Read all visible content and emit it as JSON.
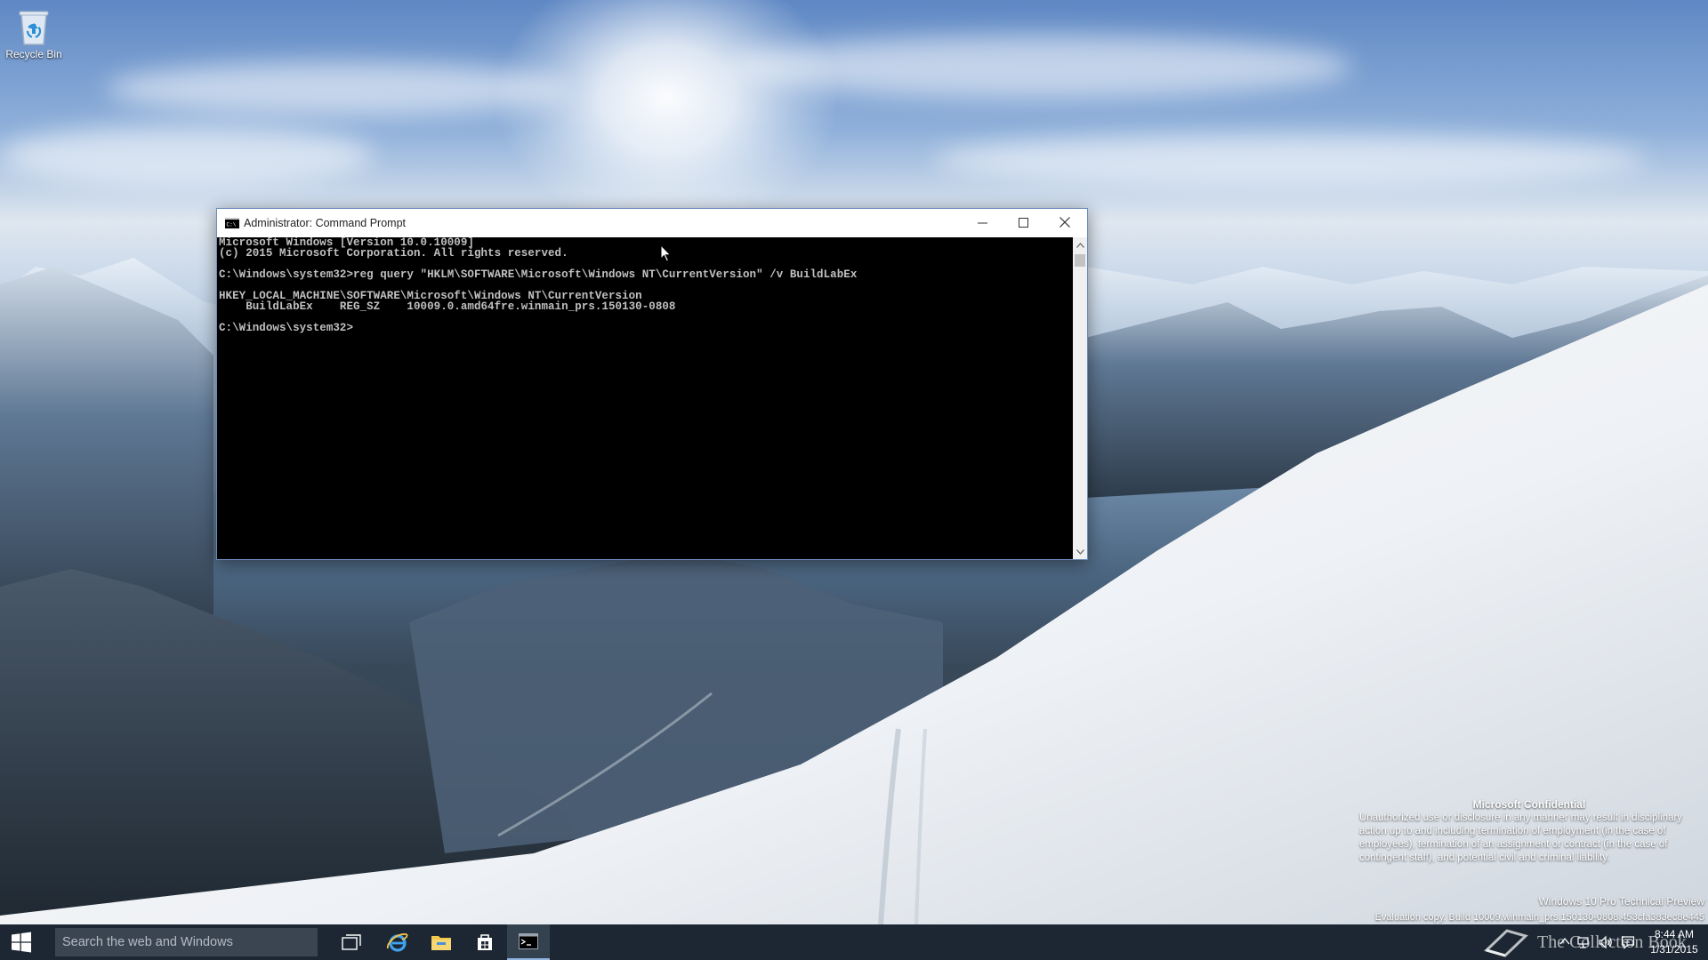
{
  "desktop": {
    "icons": [
      {
        "label": "Recycle Bin",
        "icon": "recycle-bin-icon"
      }
    ],
    "watermark": {
      "title": "Microsoft Confidential",
      "body": "Unauthorized use or disclosure in any manner may result in disciplinary action up to and including termination of employment (in the case of employees), termination of an assignment or contract (in the case of contingent staff), and potential civil and criminal liability.",
      "edition": "Windows 10 Pro Technical Preview",
      "build": "Evaluation copy. Build 10009.winmain_prs.150130-0808.453cfa383ec8e445"
    }
  },
  "window": {
    "title": "Administrator: Command Prompt",
    "icon": "console-icon",
    "controls": [
      "minimize-icon",
      "maximize-icon",
      "close-icon"
    ],
    "console_lines": [
      "Microsoft Windows [Version 10.0.10009]",
      "(c) 2015 Microsoft Corporation. All rights reserved.",
      "",
      "C:\\Windows\\system32>reg query \"HKLM\\SOFTWARE\\Microsoft\\Windows NT\\CurrentVersion\" /v BuildLabEx",
      "",
      "HKEY_LOCAL_MACHINE\\SOFTWARE\\Microsoft\\Windows NT\\CurrentVersion",
      "    BuildLabEx    REG_SZ    10009.0.amd64fre.winmain_prs.150130-0808",
      "",
      "C:\\Windows\\system32>"
    ]
  },
  "taskbar": {
    "search_placeholder": "Search the web and Windows",
    "pinned": [
      "task-view-icon",
      "internet-explorer-icon",
      "file-explorer-icon",
      "store-icon",
      "command-prompt-icon"
    ],
    "overlay_text": "The Collection Book",
    "tray": [
      "up-arrow-icon",
      "network-icon",
      "volume-icon",
      "action-center-icon"
    ],
    "clock": {
      "time": "8:44 AM",
      "date": "1/31/2015"
    }
  },
  "colors": {
    "taskbar": "#1c2733",
    "console_bg": "#000000",
    "console_text": "#c0c0c0",
    "active_accent": "#8fb4e0"
  }
}
